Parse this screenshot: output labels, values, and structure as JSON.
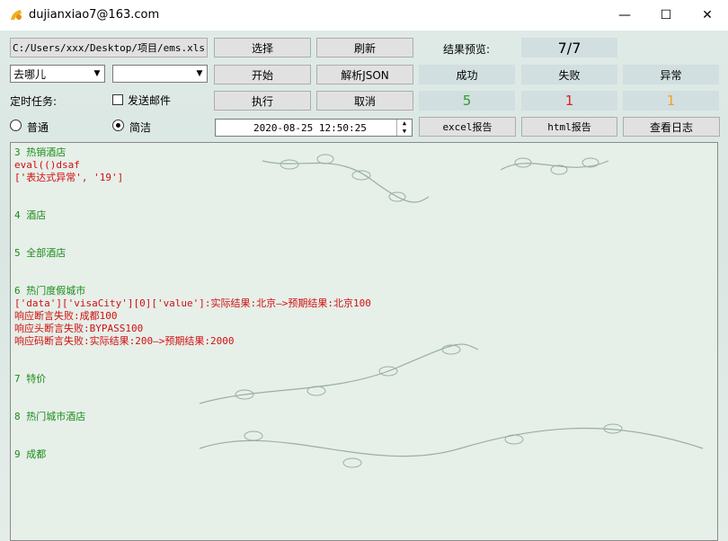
{
  "window": {
    "title": "dujianxiao7@163.com",
    "minimize_glyph": "—",
    "maximize_glyph": "☐",
    "close_glyph": "✕"
  },
  "toolbar": {
    "path_button": "C:/Users/xxx/Desktop/项目/ems.xls",
    "select_button": "选择",
    "refresh_button": "刷新",
    "start_button": "开始",
    "parse_json_button": "解析JSON",
    "execute_button": "执行",
    "cancel_button": "取消",
    "excel_report_button": "excel报告",
    "html_report_button": "html报告",
    "view_log_button": "查看日志"
  },
  "selects": {
    "first_value": "去哪儿",
    "second_value": ""
  },
  "options": {
    "scheduled_task_label": "定时任务:",
    "send_email_label": "发送邮件",
    "send_email_checked": false,
    "mode_normal_label": "普通",
    "mode_simple_label": "简洁",
    "selected_mode": "simple"
  },
  "datetime": {
    "value": "2020-08-25 12:50:25"
  },
  "results": {
    "preview_label": "结果预览:",
    "preview_value": "7/7",
    "success_label": "成功",
    "fail_label": "失败",
    "error_label": "异常",
    "success_count": "5",
    "fail_count": "1",
    "error_count": "1",
    "colors": {
      "success": "#2e9b2e",
      "fail": "#e02020",
      "error": "#f0a020"
    }
  },
  "log": [
    {
      "text": "3 热销酒店",
      "color": "green"
    },
    {
      "text": "eval(()dsaf",
      "color": "red"
    },
    {
      "text": "['表达式异常', '19']",
      "color": "red"
    },
    {
      "text": "",
      "color": "green"
    },
    {
      "text": "",
      "color": "green"
    },
    {
      "text": "4 酒店",
      "color": "green"
    },
    {
      "text": "",
      "color": "green"
    },
    {
      "text": "",
      "color": "green"
    },
    {
      "text": "5 全部酒店",
      "color": "green"
    },
    {
      "text": "",
      "color": "green"
    },
    {
      "text": "",
      "color": "green"
    },
    {
      "text": "6 热门度假城市",
      "color": "green"
    },
    {
      "text": "['data']['visaCity'][0]['value']:实际结果:北京—>预期结果:北京100",
      "color": "red"
    },
    {
      "text": "响应断言失败:成都100",
      "color": "red"
    },
    {
      "text": "响应头断言失败:BYPASS100",
      "color": "red"
    },
    {
      "text": "响应码断言失败:实际结果:200—>预期结果:2000",
      "color": "red"
    },
    {
      "text": "",
      "color": "green"
    },
    {
      "text": "",
      "color": "green"
    },
    {
      "text": "7 特价",
      "color": "green"
    },
    {
      "text": "",
      "color": "green"
    },
    {
      "text": "",
      "color": "green"
    },
    {
      "text": "8 热门城市酒店",
      "color": "green"
    },
    {
      "text": "",
      "color": "green"
    },
    {
      "text": "",
      "color": "green"
    },
    {
      "text": "9 成都",
      "color": "green"
    }
  ]
}
